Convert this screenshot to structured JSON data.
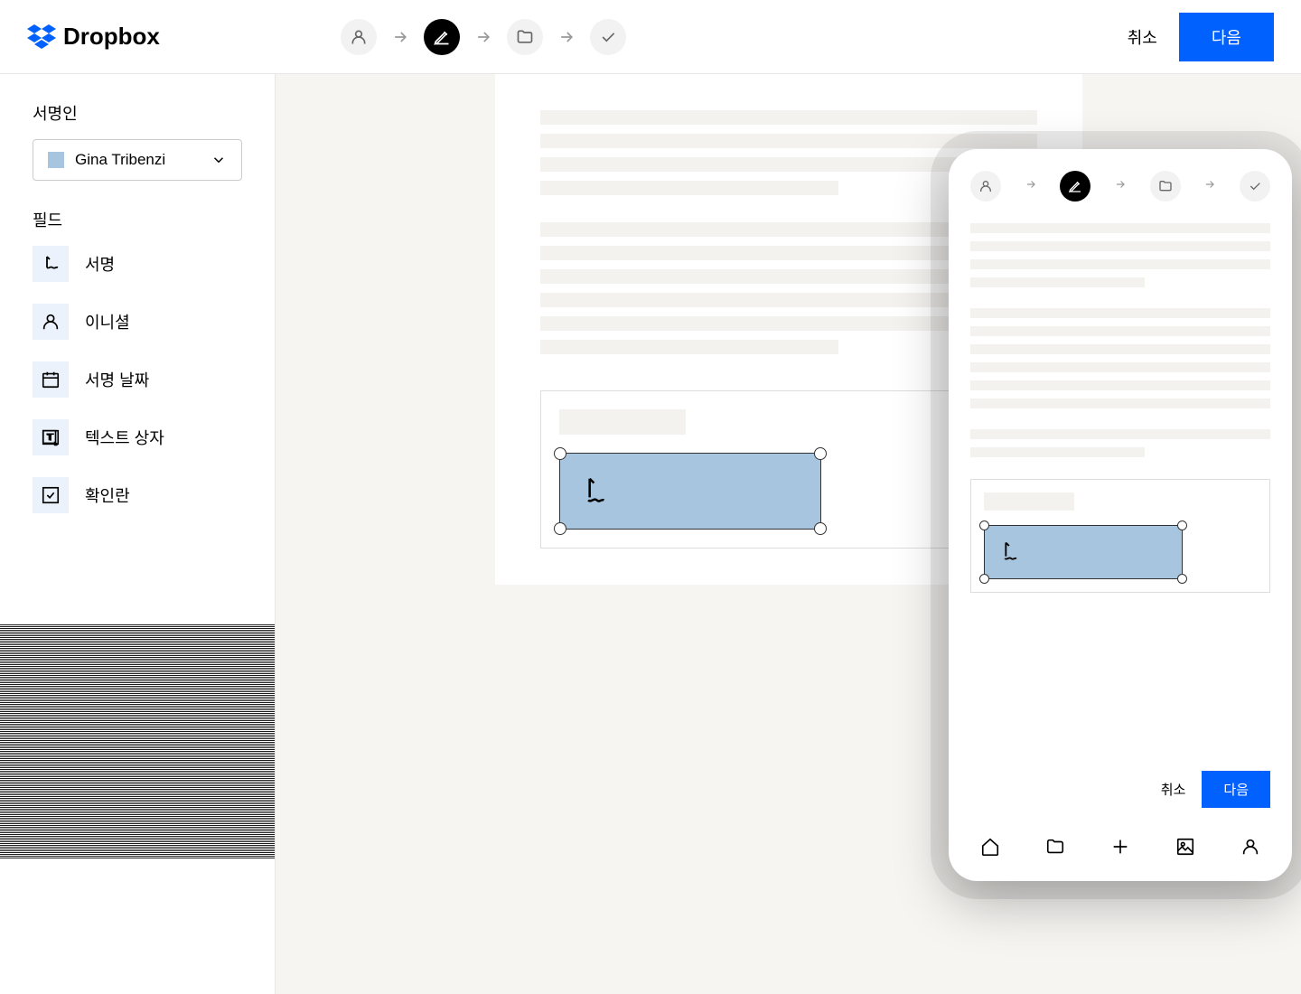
{
  "header": {
    "brand": "Dropbox",
    "cancel_label": "취소",
    "next_label": "다음"
  },
  "sidebar": {
    "signers_label": "서명인",
    "signer_name": "Gina Tribenzi",
    "fields_label": "필드",
    "fields": [
      {
        "label": "서명",
        "icon": "signature-icon"
      },
      {
        "label": "이니셜",
        "icon": "person-icon"
      },
      {
        "label": "서명 날짜",
        "icon": "date-icon"
      },
      {
        "label": "텍스트 상자",
        "icon": "textbox-icon"
      },
      {
        "label": "확인란",
        "icon": "checkbox-icon"
      }
    ]
  },
  "mobile": {
    "cancel_label": "취소",
    "next_label": "다음"
  },
  "colors": {
    "accent": "#0061fe",
    "signer": "#a8c5e0",
    "field_bg": "#ebf2fb"
  }
}
